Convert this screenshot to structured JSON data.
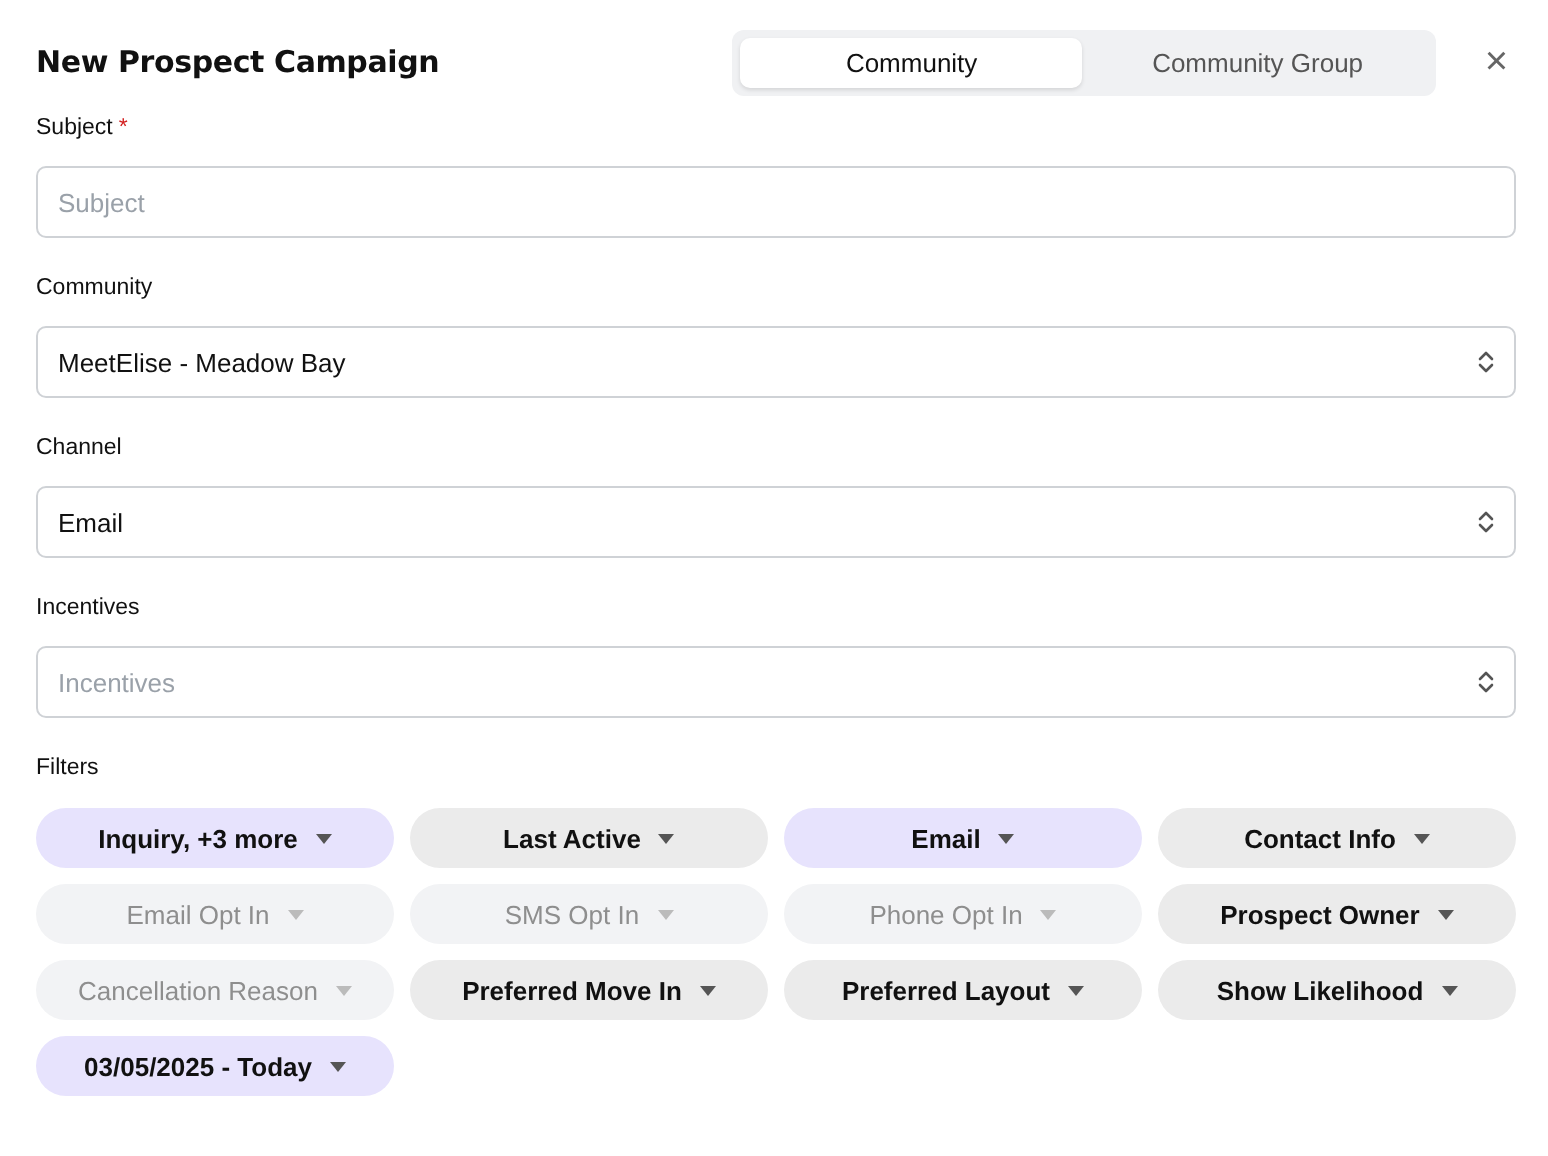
{
  "dialog": {
    "title": "New Prospect Campaign",
    "close": "×"
  },
  "tabs": [
    {
      "label": "Community",
      "selected": true
    },
    {
      "label": "Community Group",
      "selected": false
    }
  ],
  "fields": [
    {
      "label": "Subject",
      "required_mark": "*",
      "kind": "text",
      "placeholder": "Subject"
    },
    {
      "label": "Community",
      "kind": "select",
      "value": "MeetElise - Meadow Bay"
    },
    {
      "label": "Channel",
      "kind": "select",
      "value": "Email"
    },
    {
      "label": "Incentives",
      "kind": "select",
      "placeholder": "Incentives"
    }
  ],
  "filters": {
    "label": "Filters",
    "items": [
      {
        "label": "Inquiry, +3 more",
        "active": true,
        "disabled": false
      },
      {
        "label": "Last Active",
        "active": false,
        "disabled": false
      },
      {
        "label": "Email",
        "active": true,
        "disabled": false
      },
      {
        "label": "Contact Info",
        "active": false,
        "disabled": false
      },
      {
        "label": "Email Opt In",
        "active": false,
        "disabled": true
      },
      {
        "label": "SMS Opt In",
        "active": false,
        "disabled": true
      },
      {
        "label": "Phone Opt In",
        "active": false,
        "disabled": true
      },
      {
        "label": "Prospect Owner",
        "active": false,
        "disabled": false
      },
      {
        "label": "Cancellation Reason",
        "active": false,
        "disabled": true
      },
      {
        "label": "Preferred Move In",
        "active": false,
        "disabled": false
      },
      {
        "label": "Preferred Layout",
        "active": false,
        "disabled": false
      },
      {
        "label": "Show Likelihood",
        "active": false,
        "disabled": false
      },
      {
        "label": "03/05/2025 - Today",
        "active": true,
        "disabled": false
      }
    ]
  }
}
